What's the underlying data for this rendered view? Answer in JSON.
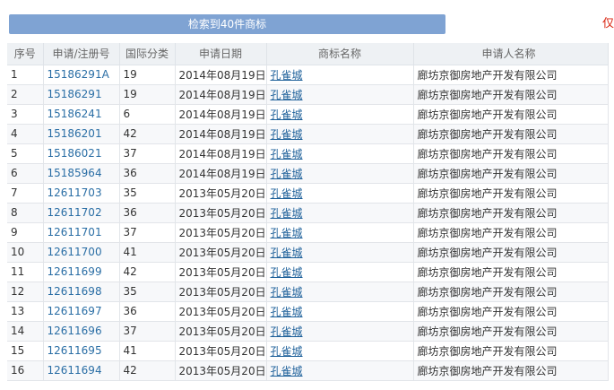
{
  "search_summary": {
    "button_label": "检索到40件商标",
    "right_note": "仅"
  },
  "table": {
    "headers": {
      "index": "序号",
      "reg_no": "申请/注册号",
      "class": "国际分类",
      "date": "申请日期",
      "mark": "商标名称",
      "applicant": "申请人名称"
    },
    "rows": [
      {
        "index": "1",
        "reg_no": "15186291A",
        "class": "19",
        "date": "2014年08月19日",
        "mark": "孔雀城",
        "applicant": "廊坊京御房地产开发有限公司"
      },
      {
        "index": "2",
        "reg_no": "15186291",
        "class": "19",
        "date": "2014年08月19日",
        "mark": "孔雀城",
        "applicant": "廊坊京御房地产开发有限公司"
      },
      {
        "index": "3",
        "reg_no": "15186241",
        "class": "6",
        "date": "2014年08月19日",
        "mark": "孔雀城",
        "applicant": "廊坊京御房地产开发有限公司"
      },
      {
        "index": "4",
        "reg_no": "15186201",
        "class": "42",
        "date": "2014年08月19日",
        "mark": "孔雀城",
        "applicant": "廊坊京御房地产开发有限公司"
      },
      {
        "index": "5",
        "reg_no": "15186021",
        "class": "37",
        "date": "2014年08月19日",
        "mark": "孔雀城",
        "applicant": "廊坊京御房地产开发有限公司"
      },
      {
        "index": "6",
        "reg_no": "15185964",
        "class": "36",
        "date": "2014年08月19日",
        "mark": "孔雀城",
        "applicant": "廊坊京御房地产开发有限公司"
      },
      {
        "index": "7",
        "reg_no": "12611703",
        "class": "35",
        "date": "2013年05月20日",
        "mark": "孔雀城",
        "applicant": "廊坊京御房地产开发有限公司"
      },
      {
        "index": "8",
        "reg_no": "12611702",
        "class": "36",
        "date": "2013年05月20日",
        "mark": "孔雀城",
        "applicant": "廊坊京御房地产开发有限公司"
      },
      {
        "index": "9",
        "reg_no": "12611701",
        "class": "37",
        "date": "2013年05月20日",
        "mark": "孔雀城",
        "applicant": "廊坊京御房地产开发有限公司"
      },
      {
        "index": "10",
        "reg_no": "12611700",
        "class": "41",
        "date": "2013年05月20日",
        "mark": "孔雀城",
        "applicant": "廊坊京御房地产开发有限公司"
      },
      {
        "index": "11",
        "reg_no": "12611699",
        "class": "42",
        "date": "2013年05月20日",
        "mark": "孔雀城",
        "applicant": "廊坊京御房地产开发有限公司"
      },
      {
        "index": "12",
        "reg_no": "12611698",
        "class": "35",
        "date": "2013年05月20日",
        "mark": "孔雀城",
        "applicant": "廊坊京御房地产开发有限公司"
      },
      {
        "index": "13",
        "reg_no": "12611697",
        "class": "36",
        "date": "2013年05月20日",
        "mark": "孔雀城",
        "applicant": "廊坊京御房地产开发有限公司"
      },
      {
        "index": "14",
        "reg_no": "12611696",
        "class": "37",
        "date": "2013年05月20日",
        "mark": "孔雀城",
        "applicant": "廊坊京御房地产开发有限公司"
      },
      {
        "index": "15",
        "reg_no": "12611695",
        "class": "41",
        "date": "2013年05月20日",
        "mark": "孔雀城",
        "applicant": "廊坊京御房地产开发有限公司"
      },
      {
        "index": "16",
        "reg_no": "12611694",
        "class": "42",
        "date": "2013年05月20日",
        "mark": "孔雀城",
        "applicant": "廊坊京御房地产开发有限公司"
      }
    ]
  },
  "colors": {
    "button_bg": "#7fa3d3",
    "header_bg": "#eef1f4",
    "link": "#2a6ea5",
    "accent_red": "#d9230f"
  }
}
